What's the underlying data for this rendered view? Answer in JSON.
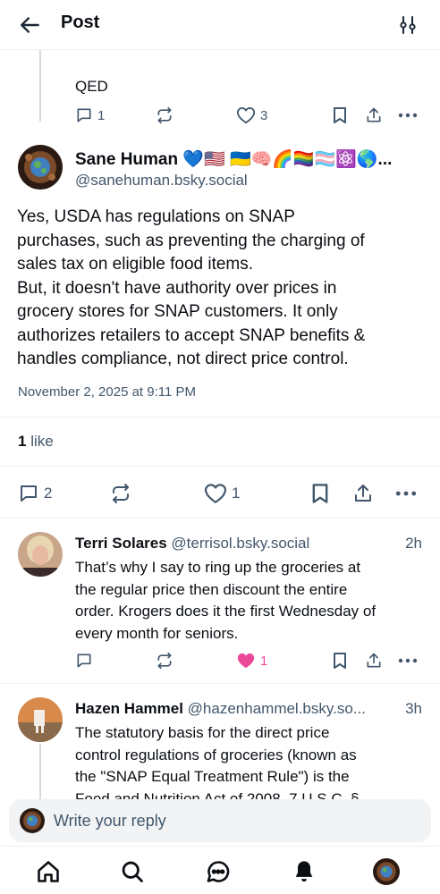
{
  "header": {
    "title": "Post"
  },
  "parent_post": {
    "text": "QED",
    "replies": "1",
    "likes": "3"
  },
  "main_post": {
    "author_name": "Sane Human 💙🇺🇸 🇺🇦🧠🌈🏳️‍🌈🏳️‍⚧️⚛️🌎...",
    "handle": "@sanehuman.bsky.social",
    "body_lines": [
      "Yes, USDA has regulations on SNAP",
      "purchases, such as preventing the charging of",
      "sales tax on eligible food items.",
      "But, it doesn't have authority over prices in",
      "grocery stores for SNAP customers. It only",
      "authorizes retailers to accept SNAP benefits &",
      "handles compliance, not direct price control."
    ],
    "date": "November 2, 2025 at 9:11 PM",
    "like_count": "1",
    "like_label": " like",
    "replies": "2",
    "likes": "1"
  },
  "replies": [
    {
      "name": "Terri Solares",
      "handle": "@terrisol.bsky.social",
      "time": "2h",
      "lines": [
        "That’s why I say to ring up the groceries at",
        "the regular price then discount the entire",
        "order. Krogers does it the first Wednesday of",
        "every month for seniors."
      ],
      "likes": "1",
      "liked": true
    },
    {
      "name": "Hazen Hammel",
      "handle": "@hazenhammel.bsky.so...",
      "time": "3h",
      "lines": [
        "The statutory basis for the direct price",
        "control regulations of groceries (known as",
        "the \"SNAP Equal Treatment Rule\") is the",
        "Food and Nutrition Act of 2008, 7 U.S.C. §"
      ]
    }
  ],
  "composer": {
    "placeholder": "Write your reply"
  },
  "nav": [
    "home-icon",
    "search-icon",
    "chat-icon",
    "bell-icon",
    "profile-avatar"
  ],
  "colors": {
    "like_pink": "#ec4899",
    "muted": "#42576c",
    "text": "#0b0f14",
    "thread_line": "#d4d9de"
  }
}
